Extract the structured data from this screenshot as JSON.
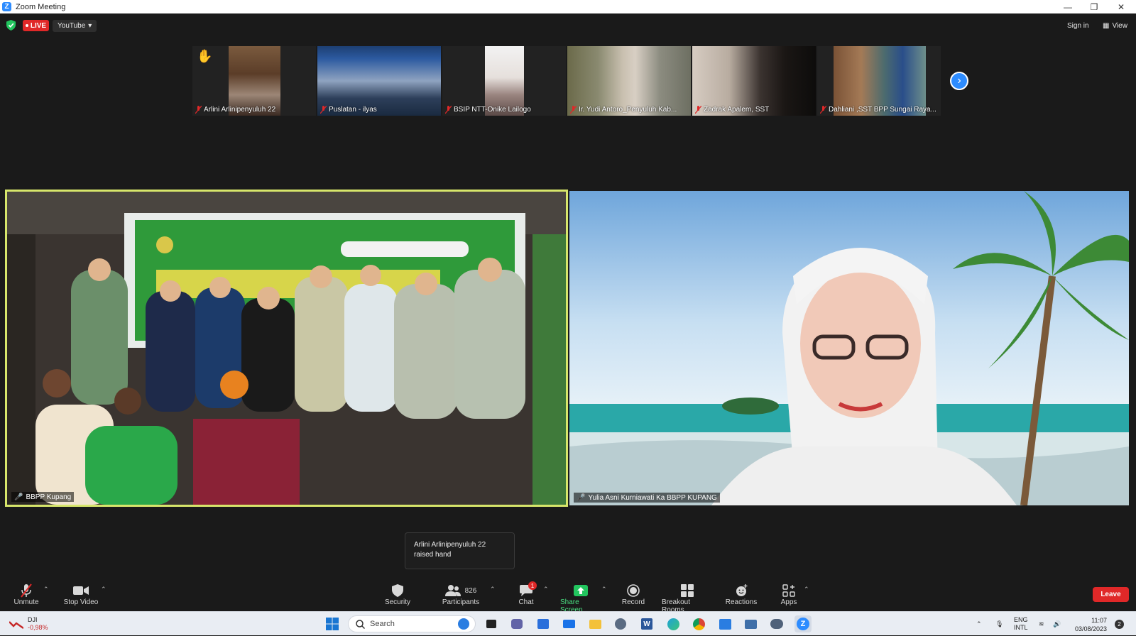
{
  "window": {
    "title": "Zoom Meeting"
  },
  "topbar": {
    "live_label": "LIVE",
    "stream_target": "YouTube",
    "sign_in": "Sign in",
    "view": "View"
  },
  "thumbnails": [
    {
      "name": "Arlini Arlinipenyuluh 22",
      "muted": true,
      "hand_raised": true
    },
    {
      "name": "Puslatan - ilyas",
      "muted": true
    },
    {
      "name": "BSIP NTT-Onike Lailogo",
      "muted": true
    },
    {
      "name": "Ir. Yudi Antoro_Penyuluh Kab...",
      "muted": true
    },
    {
      "name": "Zadrak Apalem, SST",
      "muted": true
    },
    {
      "name": "Dahliani ,SST BPP Sungai Raya...",
      "muted": true
    }
  ],
  "main_videos": {
    "left": {
      "name": "BBPP Kupang",
      "active_speaker": true
    },
    "right": {
      "name": "Yulia Asni Kurniawati Ka BBPP KUPANG"
    }
  },
  "tooltip": {
    "line1": "Arlini Arlinipenyuluh 22",
    "line2": "raised hand"
  },
  "toolbar": {
    "unmute": "Unmute",
    "stop_video": "Stop Video",
    "security": "Security",
    "participants": "Participants",
    "participants_count": "826",
    "chat": "Chat",
    "chat_badge": "1",
    "share_screen": "Share Screen",
    "record": "Record",
    "breakout_rooms": "Breakout Rooms",
    "reactions": "Reactions",
    "apps": "Apps",
    "leave": "Leave"
  },
  "taskbar": {
    "stock_name": "DJI",
    "stock_change": "-0,98%",
    "search_placeholder": "Search",
    "lang_1": "ENG",
    "lang_2": "INTL",
    "time": "11:07",
    "date": "03/08/2023",
    "notifications": "2"
  },
  "colors": {
    "accent": "#2d8cff",
    "live": "#e02828",
    "speaker_border": "#d7e66b",
    "share": "#22c55e"
  }
}
